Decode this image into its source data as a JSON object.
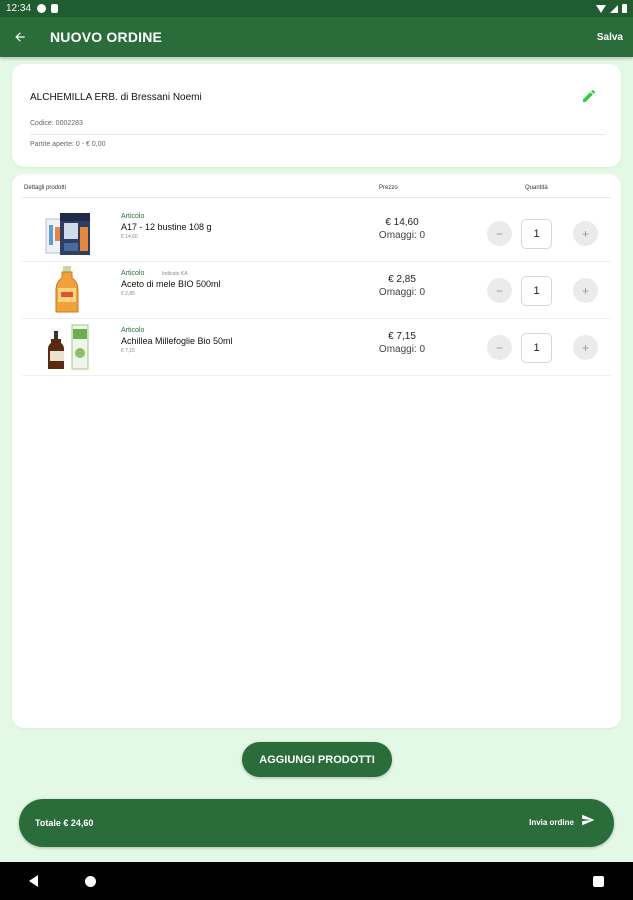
{
  "status_bar": {
    "time": "12:34"
  },
  "app_bar": {
    "title": "NUOVO ORDINE",
    "save_label": "Salva"
  },
  "customer": {
    "name": "ALCHEMILLA ERB. di Bressani Noemi",
    "code": "Codice: 0002283",
    "open_items": "Partite aperte: 0 - € 0,00"
  },
  "products_table": {
    "headers": {
      "details": "Dettagli prodotti",
      "price": "Prezzo",
      "quantity": "Quantità"
    },
    "rows": [
      {
        "kind": "Articolo",
        "tag": "",
        "name": "A17 - 12 bustine 108 g",
        "sub_price": "€ 14,60",
        "price": "€ 14,60",
        "gifts": "Omaggi: 0",
        "qty": "1"
      },
      {
        "kind": "Articolo",
        "tag": "Indicato KA",
        "name": "Aceto di mele BIO 500ml",
        "sub_price": "€ 2,85",
        "price": "€ 2,85",
        "gifts": "Omaggi: 0",
        "qty": "1"
      },
      {
        "kind": "Articolo",
        "tag": "",
        "name": "Achillea Millefoglie Bio 50ml",
        "sub_price": "€ 7,15",
        "price": "€ 7,15",
        "gifts": "Omaggi: 0",
        "qty": "1"
      }
    ]
  },
  "actions": {
    "add_products": "AGGIUNGI PRODOTTI"
  },
  "footer": {
    "total": "Totale € 24,60",
    "send_label": "Invia ordine"
  },
  "icons": {
    "back": "arrow-left-icon",
    "edit": "pencil-icon",
    "send": "send-icon",
    "minus": "minus-icon",
    "plus": "plus-icon"
  },
  "colors": {
    "primary": "#2a6d3b",
    "status_bar": "#1f5c30",
    "background": "#e3f9e5",
    "edit_icon": "#2ecc40"
  }
}
